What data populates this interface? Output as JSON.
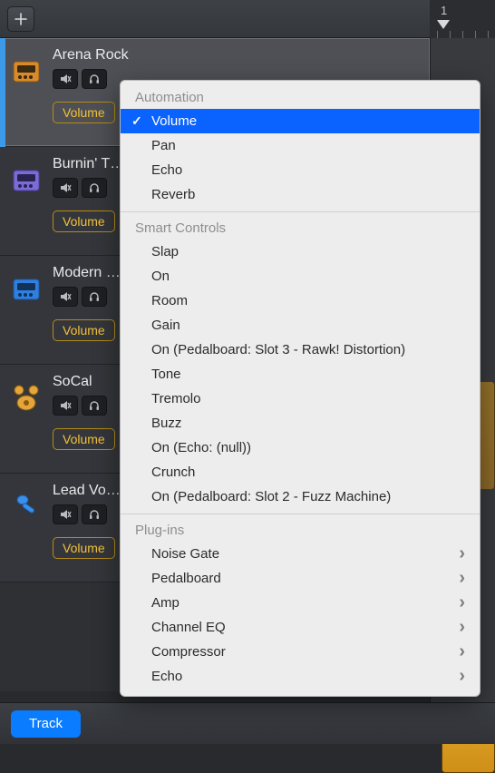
{
  "topbar": {
    "ruler_number": "1"
  },
  "tracks": [
    {
      "name": "Arena Rock",
      "param": "Volume",
      "icon": "amp-orange"
    },
    {
      "name": "Burnin' T…",
      "param": "Volume",
      "icon": "amp-purple"
    },
    {
      "name": "Modern …",
      "param": "Volume",
      "icon": "amp-blue"
    },
    {
      "name": "SoCal",
      "param": "Volume",
      "icon": "drums"
    },
    {
      "name": "Lead Vo…",
      "param": "Volume",
      "icon": "mic"
    }
  ],
  "bottombar": {
    "track_label": "Track"
  },
  "menu": {
    "sections": [
      {
        "title": "Automation",
        "items": [
          {
            "label": "Volume",
            "selected": true
          },
          {
            "label": "Pan"
          },
          {
            "label": "Echo"
          },
          {
            "label": "Reverb"
          }
        ]
      },
      {
        "title": "Smart Controls",
        "items": [
          {
            "label": "Slap"
          },
          {
            "label": "On"
          },
          {
            "label": "Room"
          },
          {
            "label": "Gain"
          },
          {
            "label": "On (Pedalboard: Slot 3 - Rawk! Distortion)"
          },
          {
            "label": "Tone"
          },
          {
            "label": "Tremolo"
          },
          {
            "label": "Buzz"
          },
          {
            "label": "On (Echo: (null))"
          },
          {
            "label": "Crunch"
          },
          {
            "label": "On (Pedalboard: Slot 2 - Fuzz Machine)"
          }
        ]
      },
      {
        "title": "Plug-ins",
        "items": [
          {
            "label": "Noise Gate",
            "submenu": true
          },
          {
            "label": "Pedalboard",
            "submenu": true
          },
          {
            "label": "Amp",
            "submenu": true
          },
          {
            "label": "Channel EQ",
            "submenu": true
          },
          {
            "label": "Compressor",
            "submenu": true
          },
          {
            "label": "Echo",
            "submenu": true
          }
        ]
      }
    ]
  }
}
